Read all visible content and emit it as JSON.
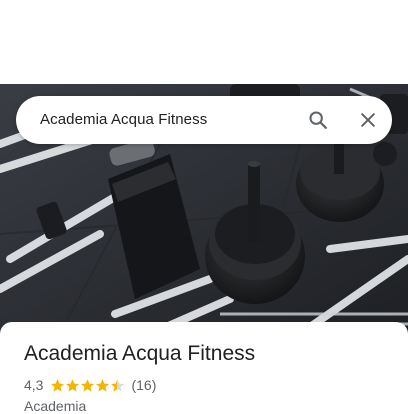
{
  "search": {
    "query": "Academia Acqua Fitness"
  },
  "place": {
    "name": "Academia Acqua Fitness",
    "rating": "4,3",
    "rating_value": 4.3,
    "review_count": "(16)",
    "category": "Academia"
  },
  "icons": {
    "search": "search-icon",
    "close": "close-icon",
    "star": "star-icon"
  },
  "colors": {
    "star": "#f4b400",
    "text_primary": "#202124",
    "text_secondary": "#5f6368"
  }
}
